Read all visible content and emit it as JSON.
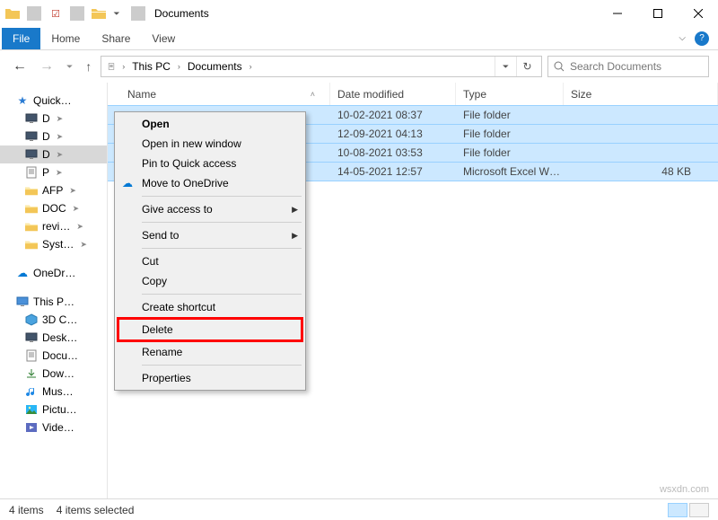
{
  "window": {
    "title": "Documents"
  },
  "ribbon": {
    "file": "File",
    "tabs": [
      "Home",
      "Share",
      "View"
    ]
  },
  "address": {
    "crumbs": [
      "This PC",
      "Documents"
    ],
    "search_placeholder": "Search Documents"
  },
  "sidebar": {
    "quick_access": {
      "label": "Quick…",
      "items": [
        {
          "label": "D",
          "icon": "monitor"
        },
        {
          "label": "D",
          "icon": "monitor"
        },
        {
          "label": "D",
          "icon": "monitor",
          "selected": true
        },
        {
          "label": "P",
          "icon": "doc"
        },
        {
          "label": "AFP",
          "icon": "folder"
        },
        {
          "label": "DOC",
          "icon": "folder"
        },
        {
          "label": "revi…",
          "icon": "folder"
        },
        {
          "label": "Syst…",
          "icon": "folder"
        }
      ]
    },
    "onedrive": {
      "label": "OneDr…"
    },
    "this_pc": {
      "label": "This P…",
      "items": [
        {
          "label": "3D C…",
          "icon": "cube"
        },
        {
          "label": "Desk…",
          "icon": "monitor"
        },
        {
          "label": "Docu…",
          "icon": "doc"
        },
        {
          "label": "Dow…",
          "icon": "download"
        },
        {
          "label": "Mus…",
          "icon": "music"
        },
        {
          "label": "Pictu…",
          "icon": "picture"
        },
        {
          "label": "Vide…",
          "icon": "video"
        }
      ]
    }
  },
  "columns": {
    "name": "Name",
    "date": "Date modified",
    "type": "Type",
    "size": "Size"
  },
  "rows": [
    {
      "name": "",
      "date": "10-02-2021 08:37",
      "type": "File folder",
      "size": "",
      "icon": "folder",
      "selected": true
    },
    {
      "name": "",
      "date": "12-09-2021 04:13",
      "type": "File folder",
      "size": "",
      "icon": "folder",
      "selected": true
    },
    {
      "name": "",
      "date": "10-08-2021 03:53",
      "type": "File folder",
      "size": "",
      "icon": "folder",
      "selected": true
    },
    {
      "name": "",
      "date": "14-05-2021 12:57",
      "type": "Microsoft Excel W…",
      "size": "48 KB",
      "icon": "excel",
      "selected": true
    }
  ],
  "context_menu": {
    "items": [
      {
        "label": "Open",
        "bold": true
      },
      {
        "label": "Open in new window"
      },
      {
        "label": "Pin to Quick access"
      },
      {
        "label": "Move to OneDrive",
        "icon": "cloud"
      },
      {
        "sep": true
      },
      {
        "label": "Give access to",
        "submenu": true
      },
      {
        "sep": true
      },
      {
        "label": "Send to",
        "submenu": true
      },
      {
        "sep": true
      },
      {
        "label": "Cut"
      },
      {
        "label": "Copy"
      },
      {
        "sep": true
      },
      {
        "label": "Create shortcut"
      },
      {
        "label": "Delete",
        "highlight": true
      },
      {
        "label": "Rename"
      },
      {
        "sep": true
      },
      {
        "label": "Properties"
      }
    ]
  },
  "status": {
    "count": "4 items",
    "selected": "4 items selected"
  },
  "watermark": "wsxdn.com"
}
